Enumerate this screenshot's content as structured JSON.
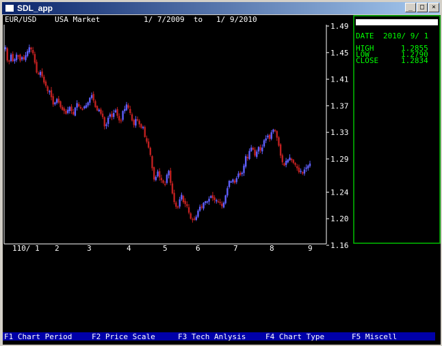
{
  "window": {
    "title": "SDL_app",
    "minimize_glyph": "_",
    "maximize_glyph": "□",
    "close_glyph": "×"
  },
  "header": {
    "symbol": "EUR/USD",
    "market": "USA Market",
    "date_range": "1/ 7/2009  to   1/ 9/2010"
  },
  "info_panel": {
    "date_label": "DATE",
    "date_value": "2010/ 9/ 1",
    "high_label": "HIGH",
    "high_value": "1.2855",
    "low_label": "LOW",
    "low_value": "1.2790",
    "close_label": "CLOSE",
    "close_value": "1.2834"
  },
  "function_bar": {
    "f1": "F1 Chart Period",
    "f2": "F2 Price Scale",
    "f3": "F3 Tech Anlysis",
    "f4": "F4 Chart Type",
    "f5": "F5 Miscell"
  },
  "colors": {
    "background": "#000000",
    "axis": "#ffffff",
    "up_candle": "#6060ff",
    "down_candle": "#c02020",
    "panel_border": "#00c000",
    "panel_text": "#00ff00",
    "function_bar": "#0000a8",
    "function_text": "#ffffff"
  },
  "chart_data": {
    "type": "candlestick",
    "title": "EUR/USD  USA Market  1/ 7/2009 to 1/ 9/2010",
    "ylim": [
      1.16,
      1.49
    ],
    "yticks": [
      1.49,
      1.45,
      1.41,
      1.37,
      1.33,
      1.29,
      1.24,
      1.2,
      1.16
    ],
    "ytick_labels": [
      "1.49",
      "1.45",
      "1.41",
      "1.37",
      "1.33",
      "1.29",
      "1.24",
      "1.20",
      "1.16"
    ],
    "xtick_labels": [
      "110/ 1",
      "2",
      "3",
      "4",
      "5",
      "6",
      "7",
      "8",
      "9"
    ],
    "series": [
      {
        "close": [
          1.458,
          1.438,
          1.437,
          1.447,
          1.437,
          1.44,
          1.447,
          1.445,
          1.438,
          1.443,
          1.44,
          1.446,
          1.452,
          1.458,
          1.455,
          1.449,
          1.435,
          1.42,
          1.418,
          1.421,
          1.414,
          1.405,
          1.4,
          1.392,
          1.392,
          1.383,
          1.372,
          1.375,
          1.38,
          1.375,
          1.368,
          1.364,
          1.362,
          1.358,
          1.364,
          1.368,
          1.362,
          1.357,
          1.367,
          1.374,
          1.369,
          1.366,
          1.365,
          1.369,
          1.371,
          1.375,
          1.382,
          1.386,
          1.378,
          1.368,
          1.363,
          1.364,
          1.358,
          1.353,
          1.339,
          1.342,
          1.352,
          1.357,
          1.353,
          1.359,
          1.363,
          1.355,
          1.348,
          1.348,
          1.362,
          1.365,
          1.372,
          1.367,
          1.359,
          1.348,
          1.341,
          1.35,
          1.348,
          1.342,
          1.337,
          1.338,
          1.323,
          1.316,
          1.307,
          1.296,
          1.276,
          1.259,
          1.263,
          1.271,
          1.262,
          1.258,
          1.254,
          1.252,
          1.266,
          1.272,
          1.254,
          1.238,
          1.225,
          1.218,
          1.217,
          1.229,
          1.236,
          1.225,
          1.222,
          1.219,
          1.209,
          1.2,
          1.199,
          1.2,
          1.203,
          1.212,
          1.218,
          1.217,
          1.224,
          1.226,
          1.226,
          1.23,
          1.234,
          1.231,
          1.228,
          1.228,
          1.226,
          1.224,
          1.219,
          1.224,
          1.235,
          1.246,
          1.257,
          1.256,
          1.259,
          1.254,
          1.261,
          1.268,
          1.266,
          1.269,
          1.28,
          1.294,
          1.291,
          1.302,
          1.307,
          1.304,
          1.295,
          1.301,
          1.308,
          1.303,
          1.307,
          1.318,
          1.321,
          1.325,
          1.32,
          1.33,
          1.334,
          1.333,
          1.322,
          1.31,
          1.295,
          1.285,
          1.28,
          1.287,
          1.289,
          1.292,
          1.288,
          1.284,
          1.281,
          1.276,
          1.27,
          1.272,
          1.268,
          1.274,
          1.277,
          1.28,
          1.283
        ]
      }
    ]
  }
}
